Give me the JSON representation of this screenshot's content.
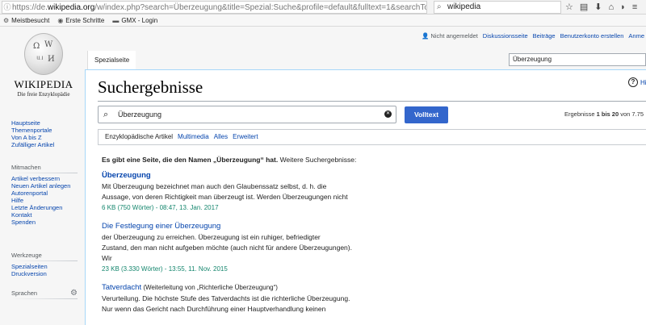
{
  "browser": {
    "url_prefix": "https://de.",
    "url_host": "wikipedia.org",
    "url_rest": "/w/index.php?search=Überzeugung&title=Spezial:Suche&profile=default&fulltext=1&searchTok",
    "search_value": "wikipedia",
    "bookmarks": [
      {
        "icon": "gear-icon",
        "label": "Meistbesucht"
      },
      {
        "icon": "firefox-icon",
        "label": "Erste Schritte"
      },
      {
        "icon": "gmx-icon",
        "label": "GMX - Login"
      }
    ]
  },
  "wiki": {
    "wordmark": "Wikipedia",
    "tagline": "Die freie Enzyklopädie",
    "personal": [
      "Nicht angemeldet",
      "Diskussionsseite",
      "Beiträge",
      "Benutzerkonto erstellen",
      "Anme"
    ],
    "nav": [
      "Hauptseite",
      "Themenportale",
      "Von A bis Z",
      "Zufälliger Artikel"
    ],
    "mitmachen_heading": "Mitmachen",
    "mitmachen": [
      "Artikel verbessern",
      "Neuen Artikel anlegen",
      "Autorenportal",
      "Hilfe",
      "Letzte Änderungen",
      "Kontakt",
      "Spenden"
    ],
    "werkzeuge_heading": "Werkzeuge",
    "werkzeuge": [
      "Spezialseiten",
      "Druckversion"
    ],
    "sprachen_heading": "Sprachen",
    "tab_label": "Spezialseite",
    "header_search_value": "Überzeugung"
  },
  "content": {
    "title": "Suchergebnisse",
    "help_label": "Hi",
    "search_value": "Überzeugung",
    "search_button": "Volltext",
    "result_count_prefix": "Ergebnisse ",
    "result_count_range": "1 bis 20",
    "result_count_suffix": " von 7.75",
    "profiles": [
      "Enzyklopädische Artikel",
      "Multimedia",
      "Alles",
      "Erweitert"
    ],
    "didyou_text": "Es gibt eine Seite, die den Namen „Überzeugung“ hat.",
    "didyou_more": " Weitere Suchergebnisse:",
    "results": [
      {
        "title": "Überzeugung",
        "lines": [
          "Mit Überzeugung bezeichnet man auch den Glaubenssatz selbst, d. h. die",
          "Aussage, von deren Richtigkeit man überzeugt ist. Werden Überzeugungen nicht"
        ],
        "meta": "6 KB (750 Wörter) - 08:47, 13. Jan. 2017"
      },
      {
        "title": "Die Festlegung einer Überzeugung",
        "lines": [
          "der Überzeugung zu erreichen. Überzeugung ist ein ruhiger, befriedigter",
          "Zustand, den man nicht aufgeben möchte (auch nicht für andere Überzeugungen).",
          "Wir"
        ],
        "meta": "23 KB (3.330 Wörter) - 13:55, 11. Nov. 2015"
      },
      {
        "title": "Tatverdacht",
        "paren": " (Weiterleitung von „Richterliche Überzeugung“)",
        "lines": [
          "Verurteilung. Die höchste Stufe des Tatverdachts ist die richterliche Überzeugung.",
          "Nur wenn das Gericht nach Durchführung einer Hauptverhandlung keinen"
        ],
        "meta": ""
      }
    ]
  }
}
